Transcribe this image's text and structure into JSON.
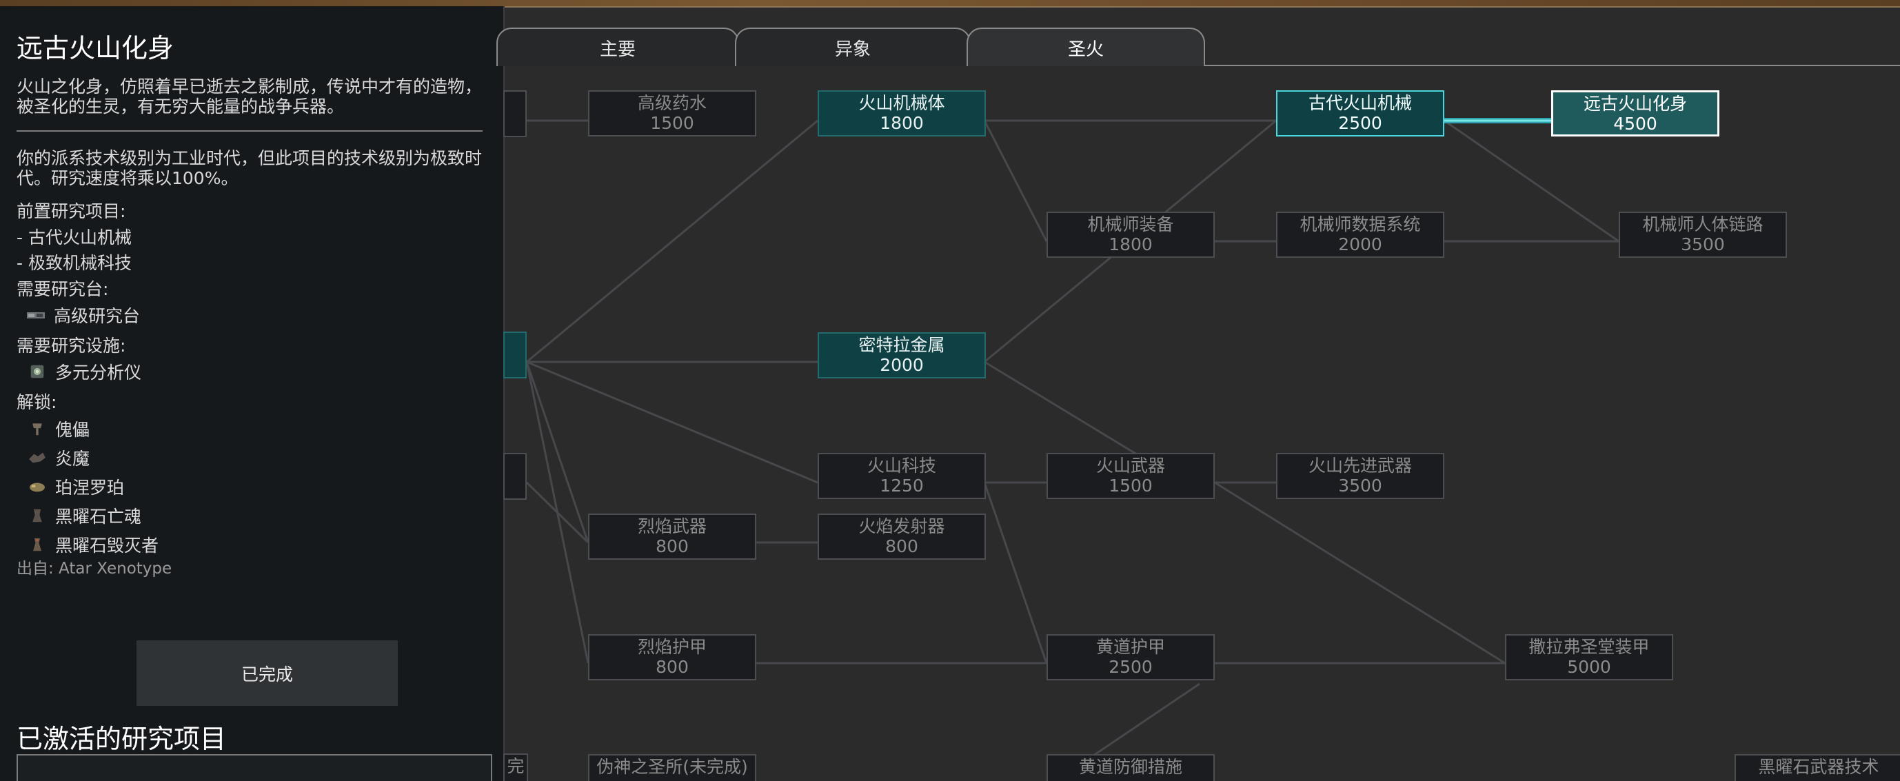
{
  "info": {
    "title": "远古火山化身",
    "description": "火山之化身，仿照着早已逝去之影制成，传说中才有的造物，被圣化的生灵，有无穷大能量的战争兵器。",
    "tech_level_note": "你的派系技术级别为工业时代，但此项目的技术级别为极致时代。研究速度将乘以100%。",
    "prereq_label": "前置研究项目:",
    "prereqs": [
      " - 古代火山机械",
      " - 极致机械科技"
    ],
    "bench_label": "需要研究台:",
    "bench": "高级研究台",
    "facility_label": "需要研究设施:",
    "facility": "多元分析仪",
    "unlocks_label": "解锁:",
    "unlocks": [
      "傀儡",
      "炎魔",
      "珀涅罗珀",
      "黑曜石亡魂",
      "黑曜石毁灭者"
    ],
    "source": "出自:  Atar Xenotype",
    "complete_button": "已完成",
    "active_title": "已激活的研究项目"
  },
  "tabs": [
    {
      "label": "主要",
      "active": false
    },
    {
      "label": "异象",
      "active": false
    },
    {
      "label": "圣火",
      "active": true
    }
  ],
  "nodes": [
    {
      "id": "n-elixir",
      "name": "高级药水",
      "cost": "1500",
      "state": "normal"
    },
    {
      "id": "n-volcanic-mech-body",
      "name": "火山机械体",
      "cost": "1800",
      "state": "done"
    },
    {
      "id": "n-ancient-volcanic-mech",
      "name": "古代火山机械",
      "cost": "2500",
      "state": "req"
    },
    {
      "id": "n-ancient-volcanic-avatar",
      "name": "远古火山化身",
      "cost": "4500",
      "state": "sel"
    },
    {
      "id": "n-mechanitor-gear",
      "name": "机械师装备",
      "cost": "1800",
      "state": "normal"
    },
    {
      "id": "n-mechanitor-data",
      "name": "机械师数据系统",
      "cost": "2000",
      "state": "normal"
    },
    {
      "id": "n-mechanitor-link",
      "name": "机械师人体链路",
      "cost": "3500",
      "state": "normal"
    },
    {
      "id": "n-mithral",
      "name": "密特拉金属",
      "cost": "2000",
      "state": "done"
    },
    {
      "id": "n-volcanic-tech",
      "name": "火山科技",
      "cost": "1250",
      "state": "normal"
    },
    {
      "id": "n-volcanic-weapons",
      "name": "火山武器",
      "cost": "1500",
      "state": "normal"
    },
    {
      "id": "n-volcanic-adv-weapons",
      "name": "火山先进武器",
      "cost": "3500",
      "state": "normal"
    },
    {
      "id": "n-blaze-weapons",
      "name": "烈焰武器",
      "cost": "800",
      "state": "normal"
    },
    {
      "id": "n-flamethrower",
      "name": "火焰发射器",
      "cost": "800",
      "state": "normal"
    },
    {
      "id": "n-blaze-armor",
      "name": "烈焰护甲",
      "cost": "800",
      "state": "normal"
    },
    {
      "id": "n-ecliptic-armor",
      "name": "黄道护甲",
      "cost": "2500",
      "state": "normal"
    },
    {
      "id": "n-sarafel-armor",
      "name": "撒拉弗圣堂装甲",
      "cost": "5000",
      "state": "normal"
    },
    {
      "id": "n-false-god-shrine",
      "name": "伪神之圣所(未完成)",
      "cost": "",
      "state": "normal"
    },
    {
      "id": "n-ecliptic-defense",
      "name": "黄道防御措施",
      "cost": "",
      "state": "normal"
    },
    {
      "id": "n-obsidian-weapon-tech",
      "name": "黑曜石武器技术",
      "cost": "",
      "state": "normal"
    },
    {
      "id": "n-stub-bottom",
      "name": "完",
      "cost": "",
      "state": "normal"
    }
  ],
  "colors": {
    "done_fill": "#0f4144",
    "required_border": "#49d6dd",
    "selected_border": "#ffffff",
    "link": "#4a4b4d",
    "active_link": "#4ec8d0"
  }
}
